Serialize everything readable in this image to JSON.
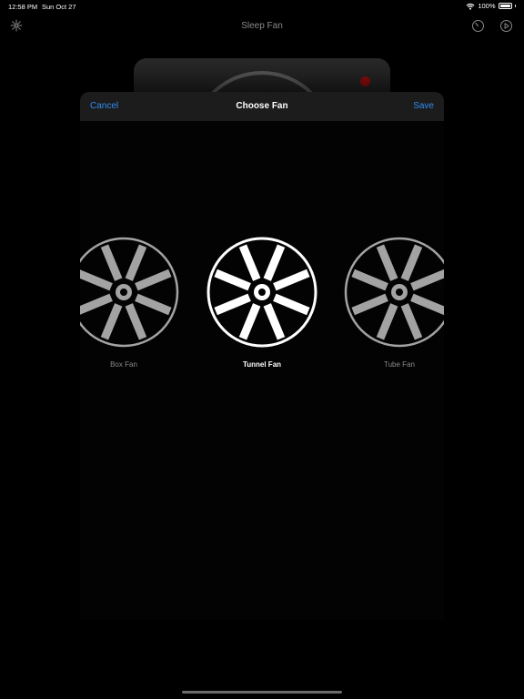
{
  "status_bar": {
    "time": "12:58 PM",
    "date": "Sun Oct 27",
    "battery": "100%",
    "battery_level": 1.0,
    "icons": [
      "wifi-icon",
      "battery-icon"
    ]
  },
  "app_bar": {
    "title": "Sleep Fan",
    "left_icon": "fan-settings-icon",
    "right_icons": [
      "timer-icon",
      "play-icon"
    ]
  },
  "sheet": {
    "title": "Choose Fan",
    "cancel_label": "Cancel",
    "save_label": "Save",
    "accent_color": "#2f8cf0"
  },
  "fans": [
    {
      "label": "Box Fan",
      "selected": false,
      "color": "#a3a3a3"
    },
    {
      "label": "Tunnel Fan",
      "selected": true,
      "color": "#ffffff"
    },
    {
      "label": "Tube Fan",
      "selected": false,
      "color": "#a3a3a3"
    }
  ]
}
